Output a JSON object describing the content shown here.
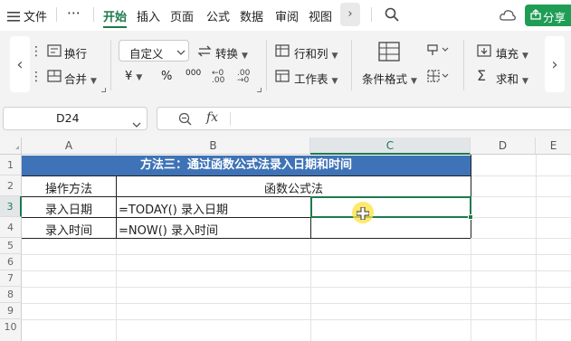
{
  "menubar": {
    "file_label": "文件",
    "more_label": "⋯",
    "tabs": [
      {
        "label": "开始",
        "active": true
      },
      {
        "label": "插入"
      },
      {
        "label": "页面"
      },
      {
        "label": "公式"
      },
      {
        "label": "数据"
      },
      {
        "label": "审阅"
      },
      {
        "label": "视图"
      }
    ],
    "share_label": "分享"
  },
  "ribbon": {
    "wrap_label": "换行",
    "merge_label": "合并",
    "number_format": "自定义",
    "convert_label": "转换",
    "currency_symbol": "¥",
    "percent_symbol": "%",
    "thousands_symbol": "000",
    "rows_cols_label": "行和列",
    "worksheet_label": "工作表",
    "conditional_format_label": "条件格式",
    "fill_label": "填充",
    "sum_label": "求和"
  },
  "formula_bar": {
    "cell_ref": "D24",
    "fx_label": "fx",
    "formula": ""
  },
  "sheet": {
    "columns": [
      "A",
      "B",
      "C",
      "D",
      "E"
    ],
    "rows": [
      "1",
      "2",
      "3",
      "4",
      "5",
      "6",
      "7",
      "8",
      "9",
      "10"
    ],
    "selected_column": "C",
    "selected_row": "3",
    "title": "方法三：通过函数公式法录入日期和时间",
    "header": {
      "method": "操作方法",
      "formula": "函数公式法"
    },
    "data_rows": [
      {
        "method": "录入日期",
        "formula": "=TODAY() 录入日期"
      },
      {
        "method": "录入时间",
        "formula": "=NOW() 录入时间"
      }
    ]
  },
  "colors": {
    "accent": "#1e7a4c",
    "title_fill": "#3f73b7",
    "share_button": "#1f9d55"
  }
}
